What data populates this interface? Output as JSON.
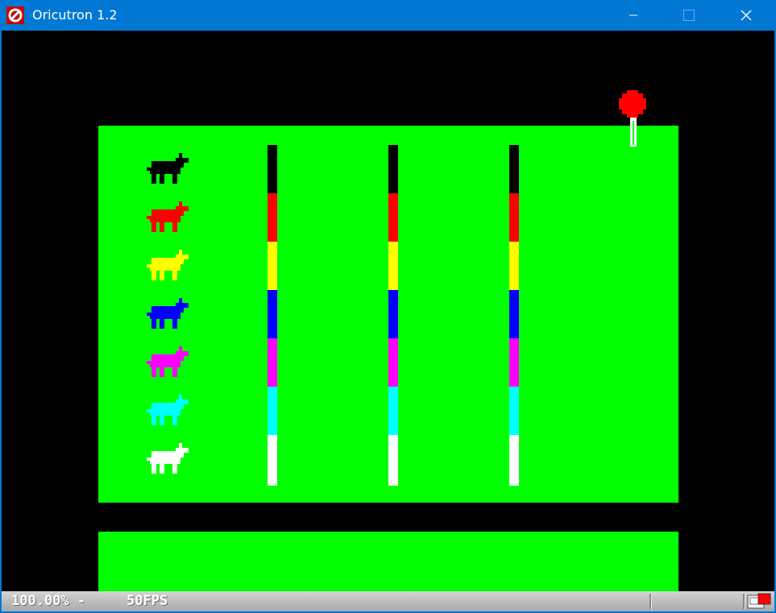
{
  "window": {
    "title": "Oricutron 1.2",
    "icon": "oricutron-logo-icon",
    "controls": [
      "minimize-icon",
      "maximize-icon",
      "close-icon"
    ]
  },
  "game": {
    "horse_colors": [
      "#000000",
      "#ff0000",
      "#ffff00",
      "#0000ff",
      "#ff00ff",
      "#00ffff",
      "#ffffff"
    ],
    "post_count": 3,
    "field_color": "#00ff00",
    "balloon_color": "#ff0000"
  },
  "status": {
    "speed": "100.00% -",
    "fps": "50FPS",
    "icon": "tape-icon"
  },
  "colors": {
    "titlebar": "#0078d4",
    "screen_bg": "#000000"
  }
}
